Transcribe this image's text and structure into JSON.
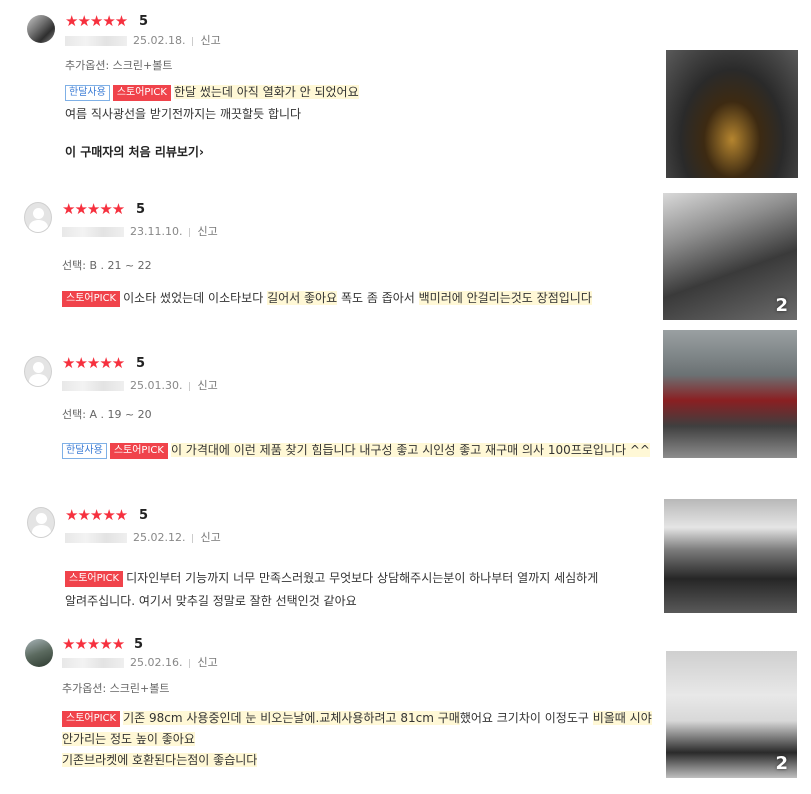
{
  "reviews": [
    {
      "rating": "5",
      "date": "25.02.18.",
      "report": "신고",
      "option": "추가옵션: 스크린+볼트",
      "badge_use": "한달사용",
      "badge_pick": "스토어PICK",
      "line1": "한달 썼는데 아직 열화가 안 되었어요",
      "line2": "여름 직사광선을 받기전까지는 깨끗할듯 합니다",
      "more": "이 구매자의 처음 리뷰보기",
      "more_arrow": "›"
    },
    {
      "rating": "5",
      "date": "23.11.10.",
      "report": "신고",
      "option": "선택: B . 21 ~ 22",
      "badge_pick": "스토어PICK",
      "line1_a": "이소타 썼었는데 이소타보다 ",
      "line1_b": "길어서 좋아요",
      "line1_c": " 폭도 좀 좁아서 ",
      "line1_d": "백미러에 안걸리는것도 장점입니다",
      "photo_count": "2"
    },
    {
      "rating": "5",
      "date": "25.01.30.",
      "report": "신고",
      "option": "선택: A . 19 ~ 20",
      "badge_use": "한달사용",
      "badge_pick": "스토어PICK",
      "line1": "이 가격대에 이런 제품 찾기 힘듭니다 내구성 좋고 시인성 좋고 재구매 의사 100프로입니다 ^^"
    },
    {
      "rating": "5",
      "date": "25.02.12.",
      "report": "신고",
      "badge_pick": "스토어PICK",
      "line1": "디자인부터 기능까지 너무 만족스러웠고 무엇보다 상담해주시는분이 하나부터 열까지 세심하게",
      "line2": "알려주십니다. 여기서 맞추길 정말로 잘한 선택인것 같아요"
    },
    {
      "rating": "5",
      "date": "25.02.16.",
      "report": "신고",
      "option": "추가옵션: 스크린+볼트",
      "badge_pick": "스토어PICK",
      "line1_a": "기존 98cm 사용중인데 눈 비오는날에.교체사용하려고 81cm 구매",
      "line1_b": "했어요 크기차이 이정도구 ",
      "line1_c": "비올때 시야",
      "line2": "안가리는 정도 높이 좋아요",
      "line3": "기존브라켓에 호환된다는점이 좋습니다",
      "photo_count": "2"
    }
  ],
  "stars": "★★★★★",
  "colors": {
    "star": "#f6303e",
    "badge_red": "#f0434b",
    "badge_blue": "#3a7bd5",
    "highlight": "#fff8d6"
  },
  "icons": {
    "avatar_default": "person-silhouette-icon"
  }
}
